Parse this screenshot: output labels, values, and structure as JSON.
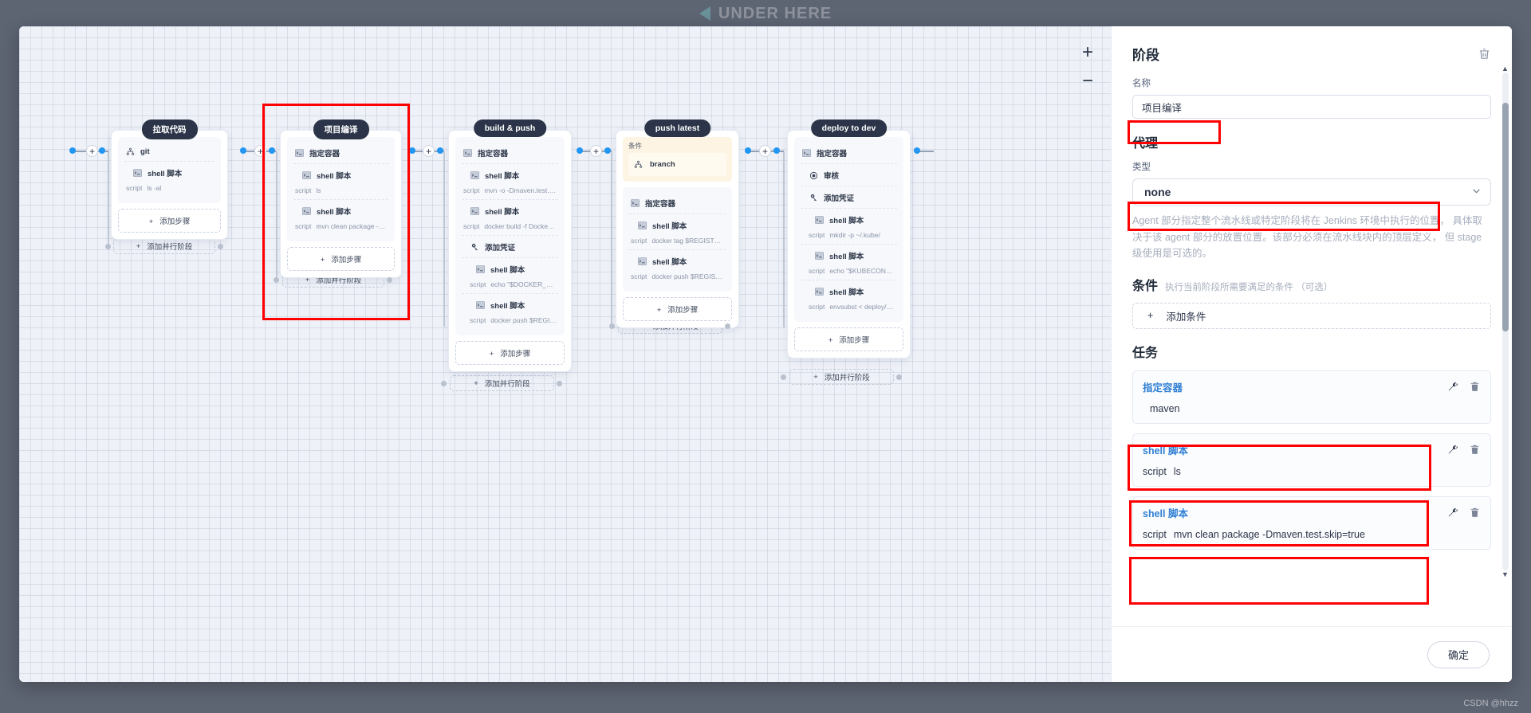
{
  "background": {
    "logo_text": "UNDER HERE",
    "watermark": "CSDN @hhzz"
  },
  "canvas": {
    "zoom_in": "+",
    "zoom_out": "−",
    "add_parallel_label": "添加并行阶段",
    "add_step_label": "添加步骤",
    "plus": "+",
    "condition_label": "条件",
    "stages": [
      {
        "title": "拉取代码",
        "steps": [
          {
            "icon": "git-icon",
            "name": "git",
            "script": ""
          },
          {
            "icon": "terminal-icon",
            "name": "shell 脚本",
            "script_key": "script",
            "script": "ls -al"
          }
        ]
      },
      {
        "title": "项目编译",
        "steps": [
          {
            "icon": "terminal-icon",
            "name": "指定容器",
            "script": ""
          },
          {
            "icon": "terminal-icon",
            "name": "shell 脚本",
            "script_key": "script",
            "script": "ls"
          },
          {
            "icon": "terminal-icon",
            "name": "shell 脚本",
            "script_key": "script",
            "script": "mvn clean package -Dmav..."
          }
        ]
      },
      {
        "title": "build & push",
        "steps": [
          {
            "icon": "terminal-icon",
            "name": "指定容器",
            "script": ""
          },
          {
            "icon": "terminal-icon",
            "name": "shell 脚本",
            "script_key": "script",
            "script": "mvn -o -Dmaven.test.skip=t..."
          },
          {
            "icon": "terminal-icon",
            "name": "shell 脚本",
            "script_key": "script",
            "script": "docker build -f Dockerfile-o..."
          },
          {
            "icon": "key-icon",
            "name": "添加凭证",
            "script": ""
          },
          {
            "icon": "terminal-icon",
            "name": "shell 脚本",
            "script_key": "script",
            "script": "echo \"$DOCKER_PASS..."
          },
          {
            "icon": "terminal-icon",
            "name": "shell 脚本",
            "script_key": "script",
            "script": "docker push $REGISTR..."
          }
        ]
      },
      {
        "title": "push latest",
        "condition": {
          "label": "条件",
          "icon": "git-branch-icon",
          "name": "branch"
        },
        "steps": [
          {
            "icon": "terminal-icon",
            "name": "指定容器",
            "script": ""
          },
          {
            "icon": "terminal-icon",
            "name": "shell 脚本",
            "script_key": "script",
            "script": "docker tag $REGISTRY/$D..."
          },
          {
            "icon": "terminal-icon",
            "name": "shell 脚本",
            "script_key": "script",
            "script": "docker push $REGISTRY/$..."
          }
        ]
      },
      {
        "title": "deploy to dev",
        "steps": [
          {
            "icon": "terminal-icon",
            "name": "指定容器",
            "script": ""
          },
          {
            "icon": "review-icon",
            "name": "审核",
            "script": ""
          },
          {
            "icon": "key-icon",
            "name": "添加凭证",
            "script": ""
          },
          {
            "icon": "terminal-icon",
            "name": "shell 脚本",
            "script_key": "script",
            "script": "mkdir -p ~/.kube/"
          },
          {
            "icon": "terminal-icon",
            "name": "shell 脚本",
            "script_key": "script",
            "script": "echo \"$KUBECONFIG_..."
          },
          {
            "icon": "terminal-icon",
            "name": "shell 脚本",
            "script_key": "script",
            "script": "envsubst < deploy/dev.o..."
          }
        ]
      }
    ]
  },
  "panel": {
    "title": "阶段",
    "delete_icon": "trash-icon",
    "name_label": "名称",
    "name_value": "项目编译",
    "agent_title": "代理",
    "type_label": "类型",
    "type_value": "none",
    "agent_desc": "Agent 部分指定整个流水线或特定阶段将在 Jenkins 环境中执行的位置， 具体取决于该 agent 部分的放置位置。该部分必须在流水线块内的顶层定义， 但 stage 级使用是可选的。",
    "condition_title": "条件",
    "condition_sub": "执行当前阶段所需要满足的条件 （可选）",
    "add_condition": "添加条件",
    "tasks_title": "任务",
    "tasks": [
      {
        "name": "指定容器",
        "key": "",
        "value": "maven",
        "edit_icon": "wrench-icon",
        "delete_icon": "trash-icon"
      },
      {
        "name": "shell 脚本",
        "key": "script",
        "value": "ls",
        "edit_icon": "wrench-icon",
        "delete_icon": "trash-icon"
      },
      {
        "name": "shell 脚本",
        "key": "script",
        "value": "mvn clean package -Dmaven.test.skip=true",
        "edit_icon": "wrench-icon",
        "delete_icon": "trash-icon"
      }
    ],
    "confirm_label": "确定"
  },
  "colors": {
    "accent_blue": "#2196f3",
    "highlight_red": "#ff0000",
    "stage_title_bg": "#2b3448",
    "link_blue": "#2f7fd4"
  }
}
